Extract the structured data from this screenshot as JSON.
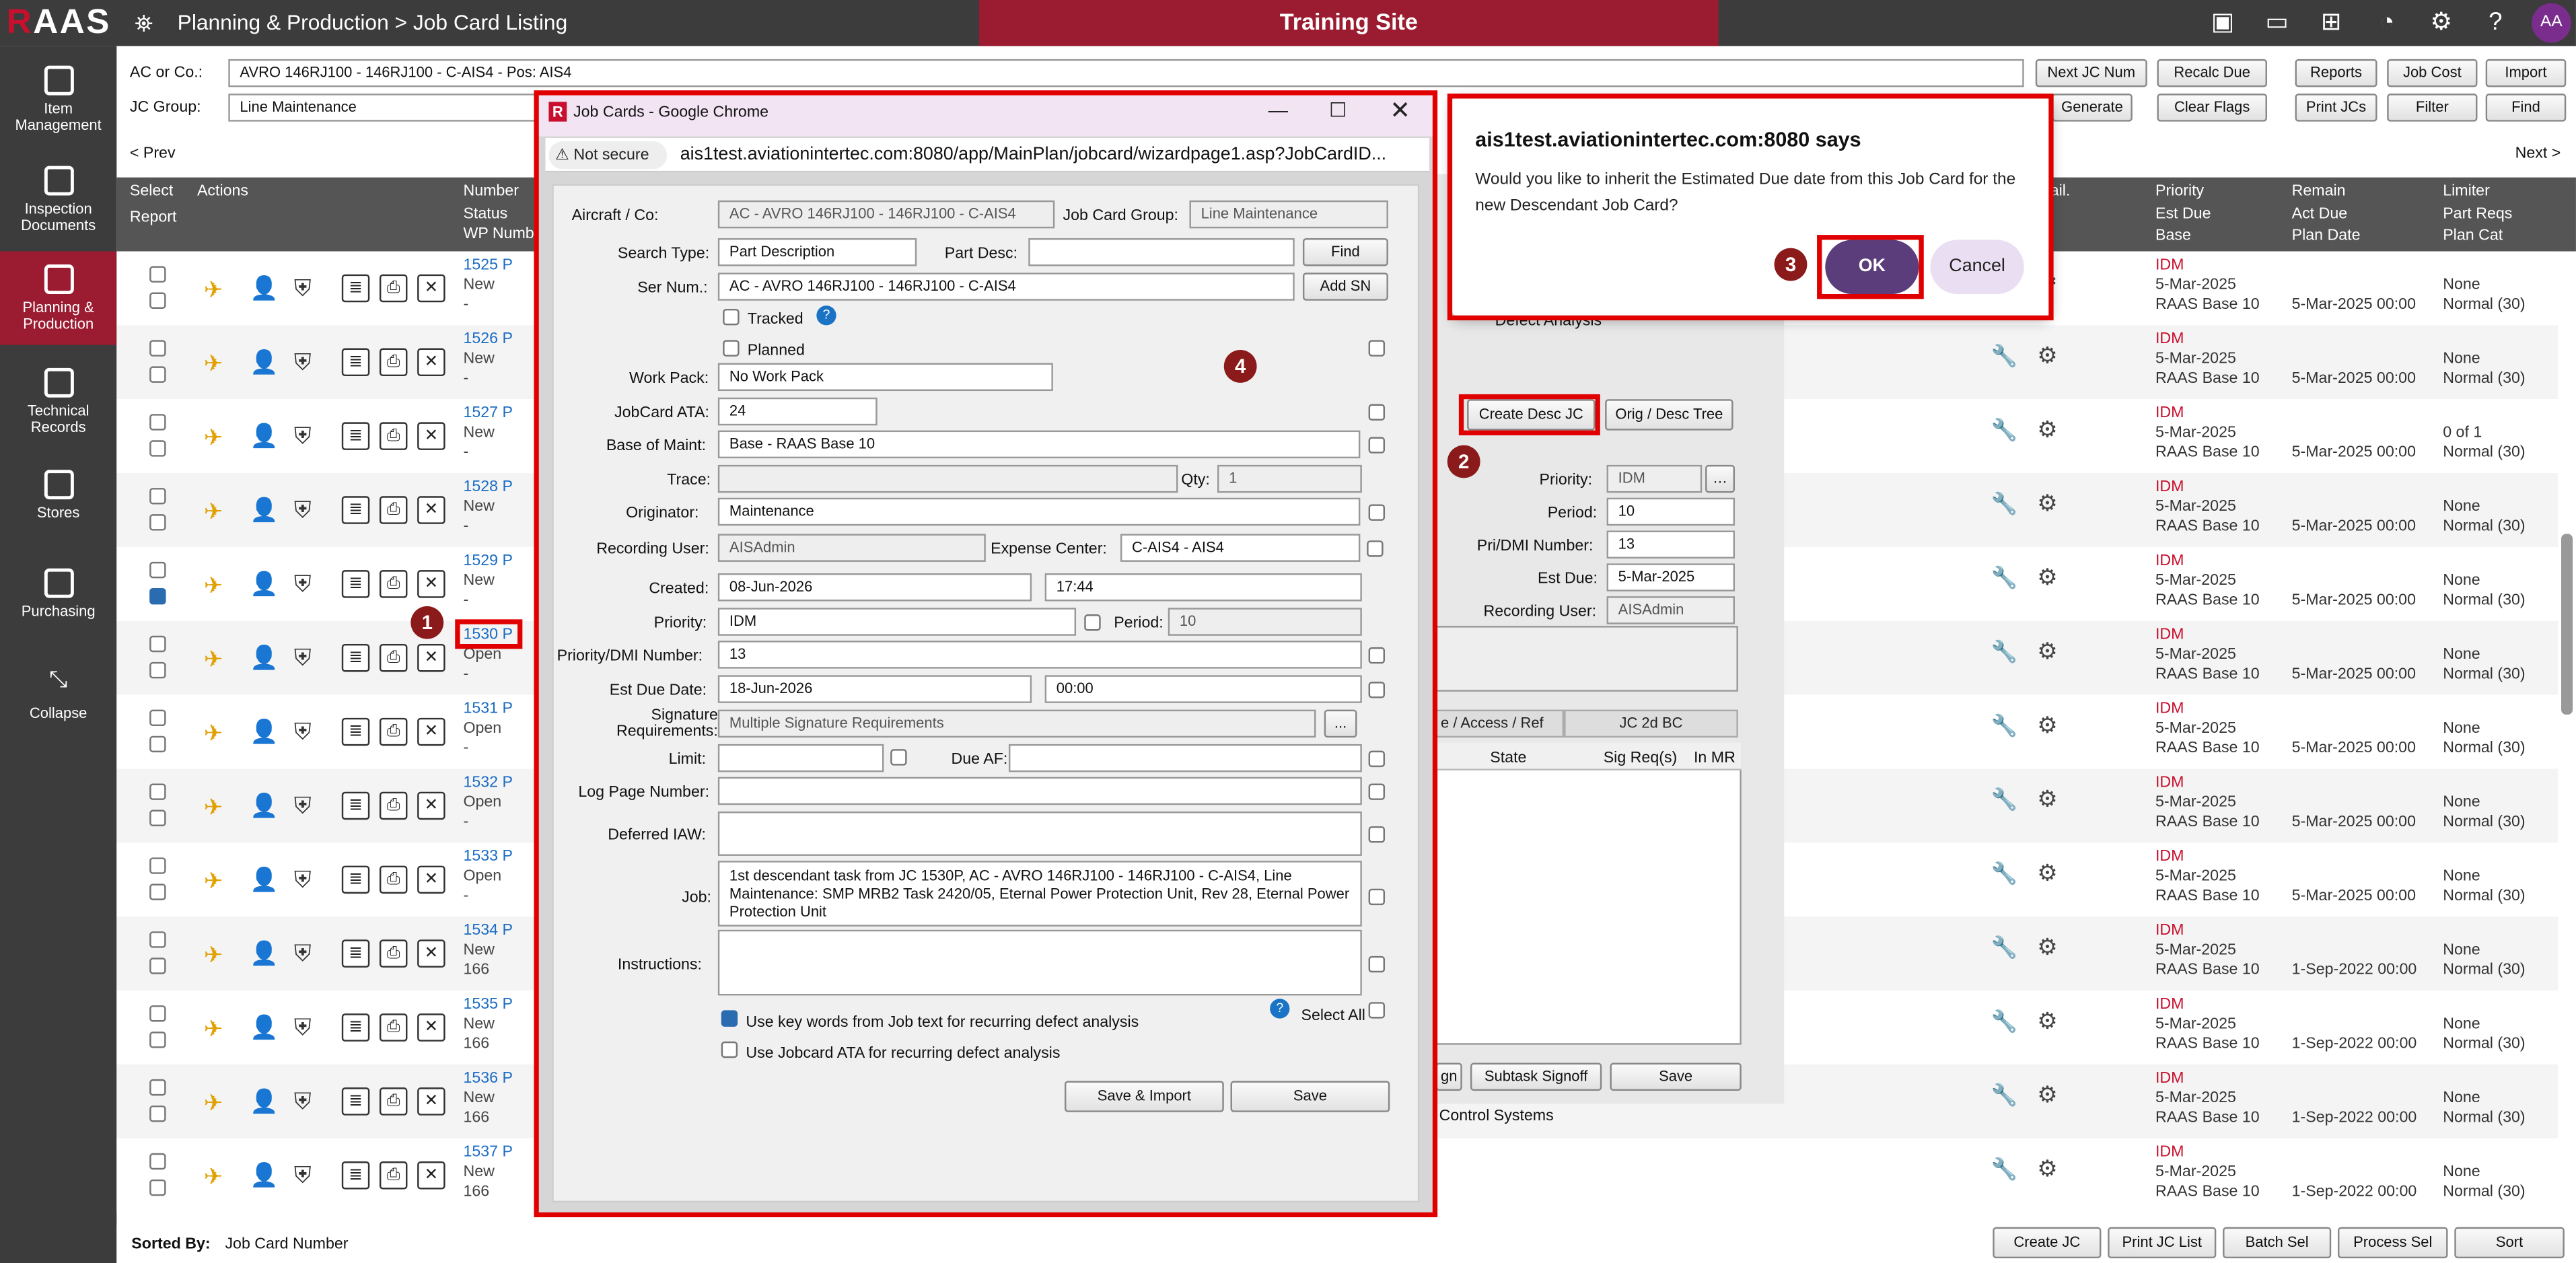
{
  "app": {
    "logo": "RAAS",
    "breadcrumb": "Planning & Production > Job Card Listing",
    "site": "Training Site",
    "avatar": "AA"
  },
  "sidebar": [
    "Item Management",
    "Inspection Documents",
    "Planning & Production",
    "Technical Records",
    "Stores",
    "Purchasing",
    "Collapse"
  ],
  "filters": {
    "ac_label": "AC or Co.:",
    "ac_value": "AVRO 146RJ100 - 146RJ100 - C-AIS4 - Pos: AIS4",
    "jc_group_label": "JC Group:",
    "jc_group_value": "Line Maintenance",
    "prev": "< Prev",
    "next": "Next >"
  },
  "toolbar": [
    "Next JC Num",
    "Recalc Due",
    "Reports",
    "Job Cost",
    "Import",
    "Generate",
    "Clear Flags",
    "Print JCs",
    "Filter",
    "Find"
  ],
  "table_headers": {
    "select": "Select",
    "actions": "Actions",
    "number": "Number",
    "report": "Report",
    "status": "Status",
    "wp": "WP Numb",
    "ail": "ail.",
    "priority": "Priority",
    "remain": "Remain",
    "limiter": "Limiter",
    "est_due": "Est Due",
    "act_due": "Act Due",
    "part_reqs": "Part Reqs",
    "base": "Base",
    "plan_date": "Plan Date",
    "plan_cat": "Plan Cat"
  },
  "rows": [
    {
      "num": "1525 P",
      "status": "New",
      "wp": "-",
      "pri": "IDM",
      "est": "5-Mar-2025",
      "base": "RAAS Base 10",
      "plan": "5-Mar-2025 00:00",
      "lim": "None",
      "cat": "Normal (30)",
      "chk": false
    },
    {
      "num": "1526 P",
      "status": "New",
      "wp": "-",
      "pri": "IDM",
      "est": "5-Mar-2025",
      "base": "RAAS Base 10",
      "plan": "5-Mar-2025 00:00",
      "lim": "None",
      "cat": "Normal (30)",
      "chk": false
    },
    {
      "num": "1527 P",
      "status": "New",
      "wp": "-",
      "pri": "IDM",
      "est": "5-Mar-2025",
      "base": "RAAS Base 10",
      "plan": "5-Mar-2025 00:00",
      "lim": "0 of 1",
      "cat": "Normal (30)",
      "chk": false
    },
    {
      "num": "1528 P",
      "status": "New",
      "wp": "-",
      "pri": "IDM",
      "est": "5-Mar-2025",
      "base": "RAAS Base 10",
      "plan": "5-Mar-2025 00:00",
      "lim": "None",
      "cat": "Normal (30)",
      "chk": false
    },
    {
      "num": "1529 P",
      "status": "New",
      "wp": "-",
      "pri": "IDM",
      "est": "5-Mar-2025",
      "base": "RAAS Base 10",
      "plan": "5-Mar-2025 00:00",
      "lim": "None",
      "cat": "Normal (30)",
      "chk": true
    },
    {
      "num": "1530 P",
      "status": "Open",
      "wp": "-",
      "pri": "IDM",
      "est": "5-Mar-2025",
      "base": "RAAS Base 10",
      "plan": "5-Mar-2025 00:00",
      "lim": "None",
      "cat": "Normal (30)",
      "chk": false
    },
    {
      "num": "1531 P",
      "status": "Open",
      "wp": "-",
      "pri": "IDM",
      "est": "5-Mar-2025",
      "base": "RAAS Base 10",
      "plan": "5-Mar-2025 00:00",
      "lim": "None",
      "cat": "Normal (30)",
      "chk": false
    },
    {
      "num": "1532 P",
      "status": "Open",
      "wp": "-",
      "pri": "IDM",
      "est": "5-Mar-2025",
      "base": "RAAS Base 10",
      "plan": "5-Mar-2025 00:00",
      "lim": "None",
      "cat": "Normal (30)",
      "chk": false
    },
    {
      "num": "1533 P",
      "status": "Open",
      "wp": "-",
      "pri": "IDM",
      "est": "5-Mar-2025",
      "base": "RAAS Base 10",
      "plan": "5-Mar-2025 00:00",
      "lim": "None",
      "cat": "Normal (30)",
      "chk": false
    },
    {
      "num": "1534 P",
      "status": "New",
      "wp": "166",
      "pri": "IDM",
      "est": "5-Mar-2025",
      "base": "RAAS Base 10",
      "plan": "1-Sep-2022 00:00",
      "lim": "None",
      "cat": "Normal (30)",
      "chk": false
    },
    {
      "num": "1535 P",
      "status": "New",
      "wp": "166",
      "pri": "IDM",
      "est": "5-Mar-2025",
      "base": "RAAS Base 10",
      "plan": "1-Sep-2022 00:00",
      "lim": "None",
      "cat": "Normal (30)",
      "chk": false
    },
    {
      "num": "1536 P",
      "status": "New",
      "wp": "166",
      "pri": "IDM",
      "est": "5-Mar-2025",
      "base": "RAAS Base 10",
      "plan": "1-Sep-2022 00:00",
      "lim": "None",
      "cat": "Normal (30)",
      "chk": false
    },
    {
      "num": "1537 P",
      "status": "New",
      "wp": "166",
      "pri": "IDM",
      "est": "5-Mar-2025",
      "base": "RAAS Base 10",
      "plan": "1-Sep-2022 00:00",
      "lim": "None",
      "cat": "Normal (30)",
      "chk": false
    }
  ],
  "popup": {
    "title": "Job Cards - Google Chrome",
    "not_secure": "Not secure",
    "url": "ais1test.aviationintertec.com:8080/app/MainPlan/jobcard/wizardpage1.asp?JobCardID...",
    "aircraft_label": "Aircraft / Co:",
    "aircraft": "AC - AVRO 146RJ100 - 146RJ100 - C-AIS4",
    "group_label": "Job Card Group:",
    "group": "Line Maintenance",
    "search_type_label": "Search Type:",
    "search_type": "Part Description",
    "part_desc_label": "Part Desc:",
    "find": "Find",
    "ser_num_label": "Ser Num.:",
    "ser_num": "AC - AVRO 146RJ100 - 146RJ100 - C-AIS4",
    "add_sn": "Add SN",
    "tracked": "Tracked",
    "planned": "Planned",
    "work_pack_label": "Work Pack:",
    "work_pack": "No Work Pack",
    "ata_label": "JobCard ATA:",
    "ata": "24",
    "base_label": "Base of Maint:",
    "base": "Base - RAAS Base 10",
    "trace_label": "Trace:",
    "qty_label": "Qty:",
    "qty": "1",
    "originator_label": "Originator:",
    "originator": "Maintenance",
    "rec_user_label": "Recording User:",
    "rec_user": "AISAdmin",
    "expense_label": "Expense Center:",
    "expense": "C-AIS4 - AIS4",
    "created_label": "Created:",
    "created_date": "08-Jun-2026",
    "created_time": "17:44",
    "priority_label": "Priority:",
    "priority": "IDM",
    "period_label": "Period:",
    "period": "10",
    "dmi_label": "Priority/DMI Number:",
    "dmi": "13",
    "est_due_label": "Est Due Date:",
    "est_due": "18-Jun-2026",
    "est_due_time": "00:00",
    "sig_label": "Signature Requirements:",
    "sig": "Multiple Signature Requirements",
    "sig_btn": "...",
    "limit_label": "Limit:",
    "due_af_label": "Due AF:",
    "log_label": "Log Page Number:",
    "iaw_label": "Deferred IAW:",
    "job_label": "Job:",
    "job": "1st  descendant task from JC 1530P, AC - AVRO 146RJ100 - 146RJ100 - C-AIS4, Line Maintenance: SMP MRB2 Task 2420/05, Eternal Power Protection Unit, Rev 28, Eternal Power Protection Unit",
    "instructions_label": "Instructions:",
    "use_keywords": "Use key words from Job text for recurring defect analysis",
    "use_ata": "Use Jobcard ATA for recurring defect analysis",
    "select_all": "Select All",
    "save_import": "Save & Import",
    "save": "Save"
  },
  "background_panel": {
    "defect": "Defect Analysis",
    "create_desc": "Create Desc JC",
    "orig_tree": "Orig / Desc Tree",
    "priority_label": "Priority:",
    "priority": "IDM",
    "period_label": "Period:",
    "period": "10",
    "dmi_label": "Pri/DMI Number:",
    "dmi": "13",
    "est_due_label": "Est Due:",
    "est_due": "5-Mar-2025",
    "rec_label": "Recording User:",
    "rec": "AISAdmin",
    "tab1": "e / Access / Ref",
    "tab2": "JC 2d BC",
    "col_state": "State",
    "col_sig": "Sig Req(s)",
    "col_mr": "In MR",
    "btn_gn": "gn",
    "btn_subtask": "Subtask Signoff",
    "btn_save": "Save",
    "control": "Control Systems"
  },
  "dialog": {
    "title": "ais1test.aviationintertec.com:8080 says",
    "message": "Would you like to inherit the Estimated Due date from this Job Card for the new Descendant Job Card?",
    "ok": "OK",
    "cancel": "Cancel"
  },
  "badges": [
    "1",
    "2",
    "3",
    "4"
  ],
  "bottom": {
    "sorted_label": "Sorted By:",
    "sorted_value": "Job Card Number",
    "buttons": [
      "Create JC",
      "Print JC List",
      "Batch Sel",
      "Process Sel",
      "Sort"
    ]
  },
  "colors": {
    "brand": "#9b1b30",
    "highlight": "#e00000",
    "ok": "#5a3d7a"
  }
}
